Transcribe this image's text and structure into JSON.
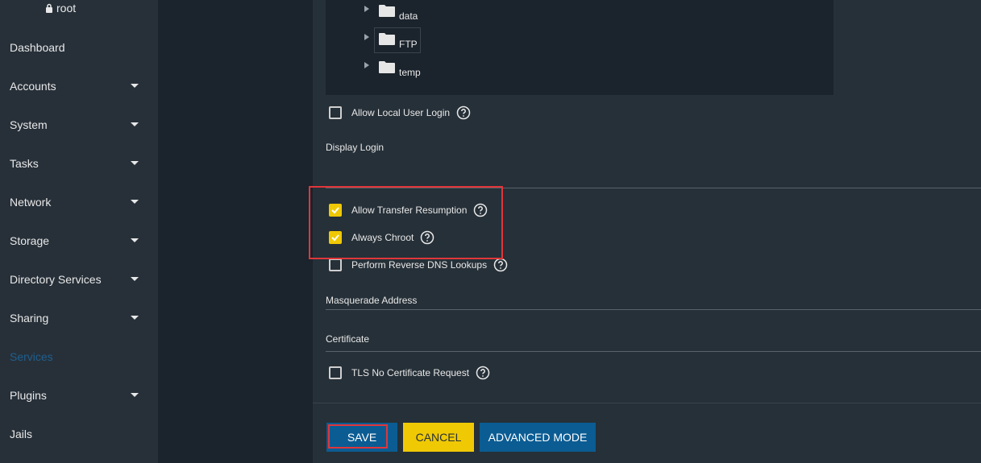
{
  "user": {
    "name": "root"
  },
  "sidebar": {
    "items": [
      {
        "label": "Dashboard",
        "has_caret": false
      },
      {
        "label": "Accounts",
        "has_caret": true
      },
      {
        "label": "System",
        "has_caret": true
      },
      {
        "label": "Tasks",
        "has_caret": true
      },
      {
        "label": "Network",
        "has_caret": true
      },
      {
        "label": "Storage",
        "has_caret": true
      },
      {
        "label": "Directory Services",
        "has_caret": true
      },
      {
        "label": "Sharing",
        "has_caret": true
      },
      {
        "label": "Services",
        "has_caret": false,
        "active": true
      },
      {
        "label": "Plugins",
        "has_caret": true
      },
      {
        "label": "Jails",
        "has_caret": false
      }
    ]
  },
  "tree": {
    "nodes": [
      {
        "name": "data"
      },
      {
        "name": "FTP"
      },
      {
        "name": "temp"
      }
    ]
  },
  "form": {
    "allow_local_user_login": {
      "label": "Allow Local User Login",
      "checked": false
    },
    "display_login": {
      "label": "Display Login"
    },
    "allow_transfer_resumption": {
      "label": "Allow Transfer Resumption",
      "checked": true
    },
    "always_chroot": {
      "label": "Always Chroot",
      "checked": true
    },
    "perform_reverse_dns": {
      "label": "Perform Reverse DNS Lookups",
      "checked": false
    },
    "masquerade_address": {
      "label": "Masquerade Address"
    },
    "certificate": {
      "label": "Certificate"
    },
    "tls_no_cert_request": {
      "label": "TLS No Certificate Request",
      "checked": false
    }
  },
  "buttons": {
    "save": "SAVE",
    "cancel": "CANCEL",
    "advanced": "ADVANCED MODE"
  },
  "colors": {
    "accent_yellow": "#f0c905",
    "accent_blue": "#0b5c93",
    "highlight_red": "#e0363a"
  }
}
